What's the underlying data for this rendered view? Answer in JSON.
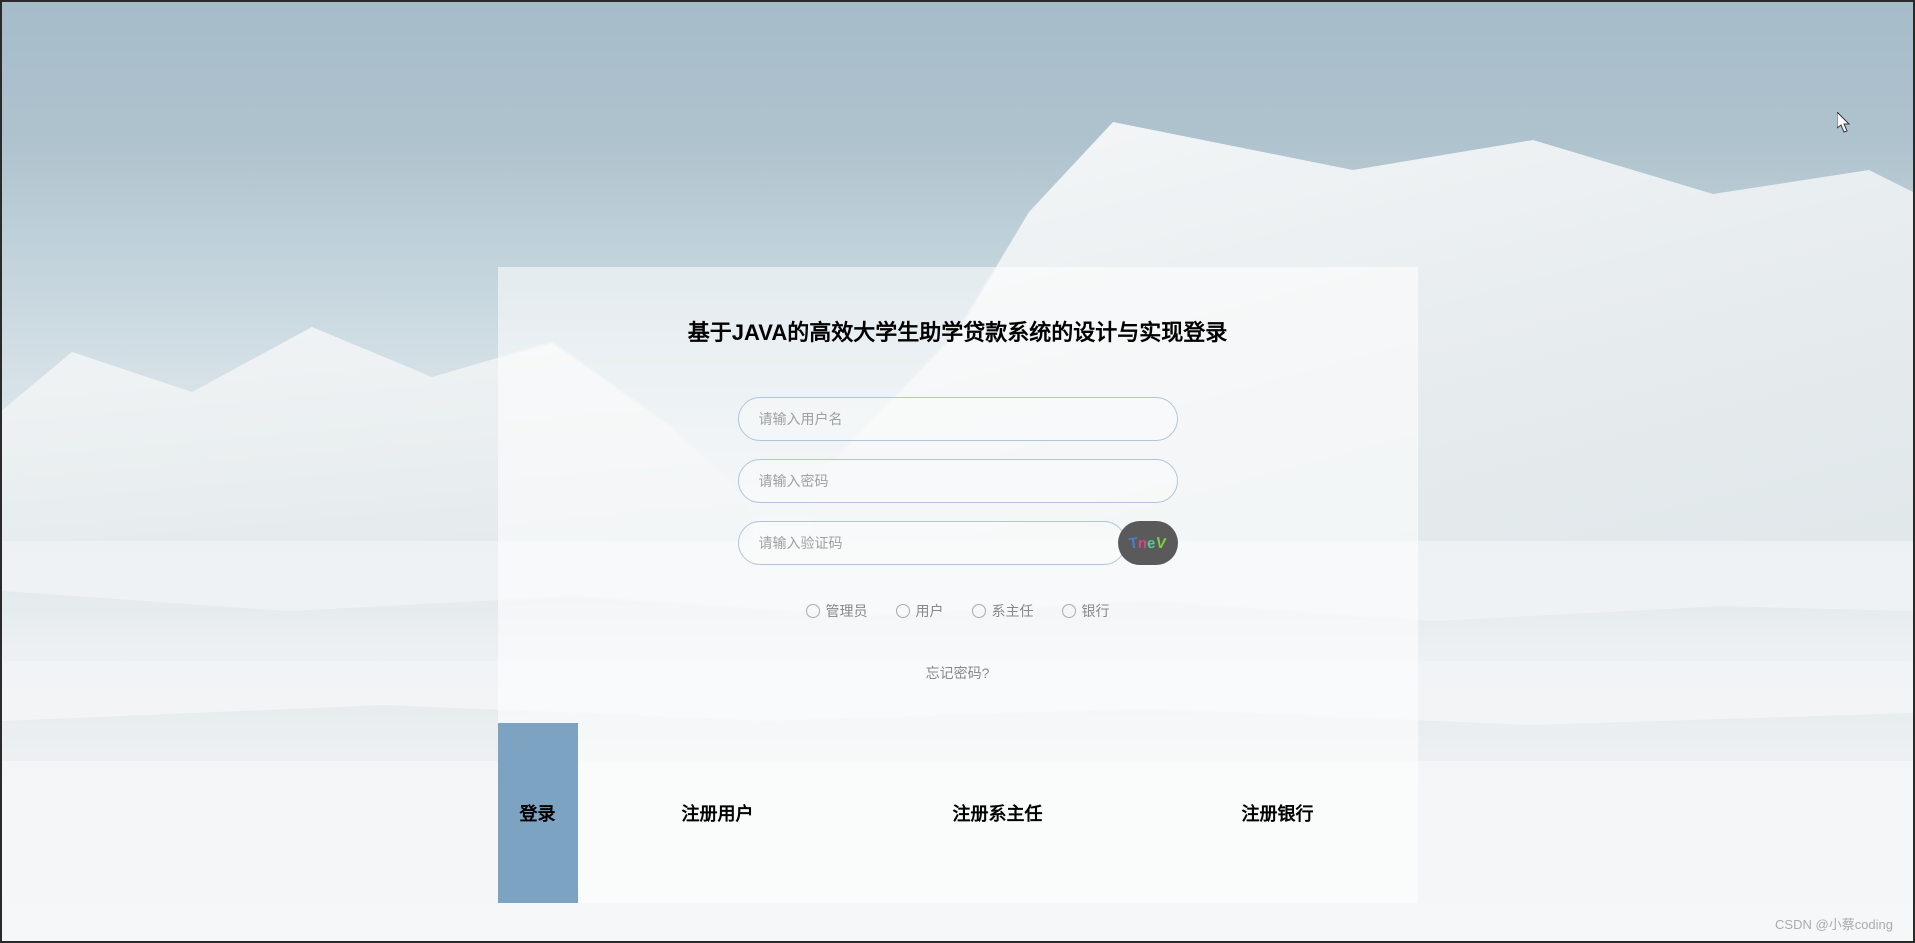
{
  "title": "基于JAVA的高效大学生助学贷款系统的设计与实现登录",
  "inputs": {
    "username_placeholder": "请输入用户名",
    "password_placeholder": "请输入密码",
    "captcha_placeholder": "请输入验证码"
  },
  "captcha": {
    "chars": [
      "T",
      "n",
      "e",
      "V"
    ]
  },
  "roles": [
    {
      "label": "管理员"
    },
    {
      "label": "用户"
    },
    {
      "label": "系主任"
    },
    {
      "label": "银行"
    }
  ],
  "forgot_password": "忘记密码?",
  "buttons": {
    "login": "登录",
    "register_user": "注册用户",
    "register_dean": "注册系主任",
    "register_bank": "注册银行"
  },
  "watermark": "CSDN @小蔡coding"
}
